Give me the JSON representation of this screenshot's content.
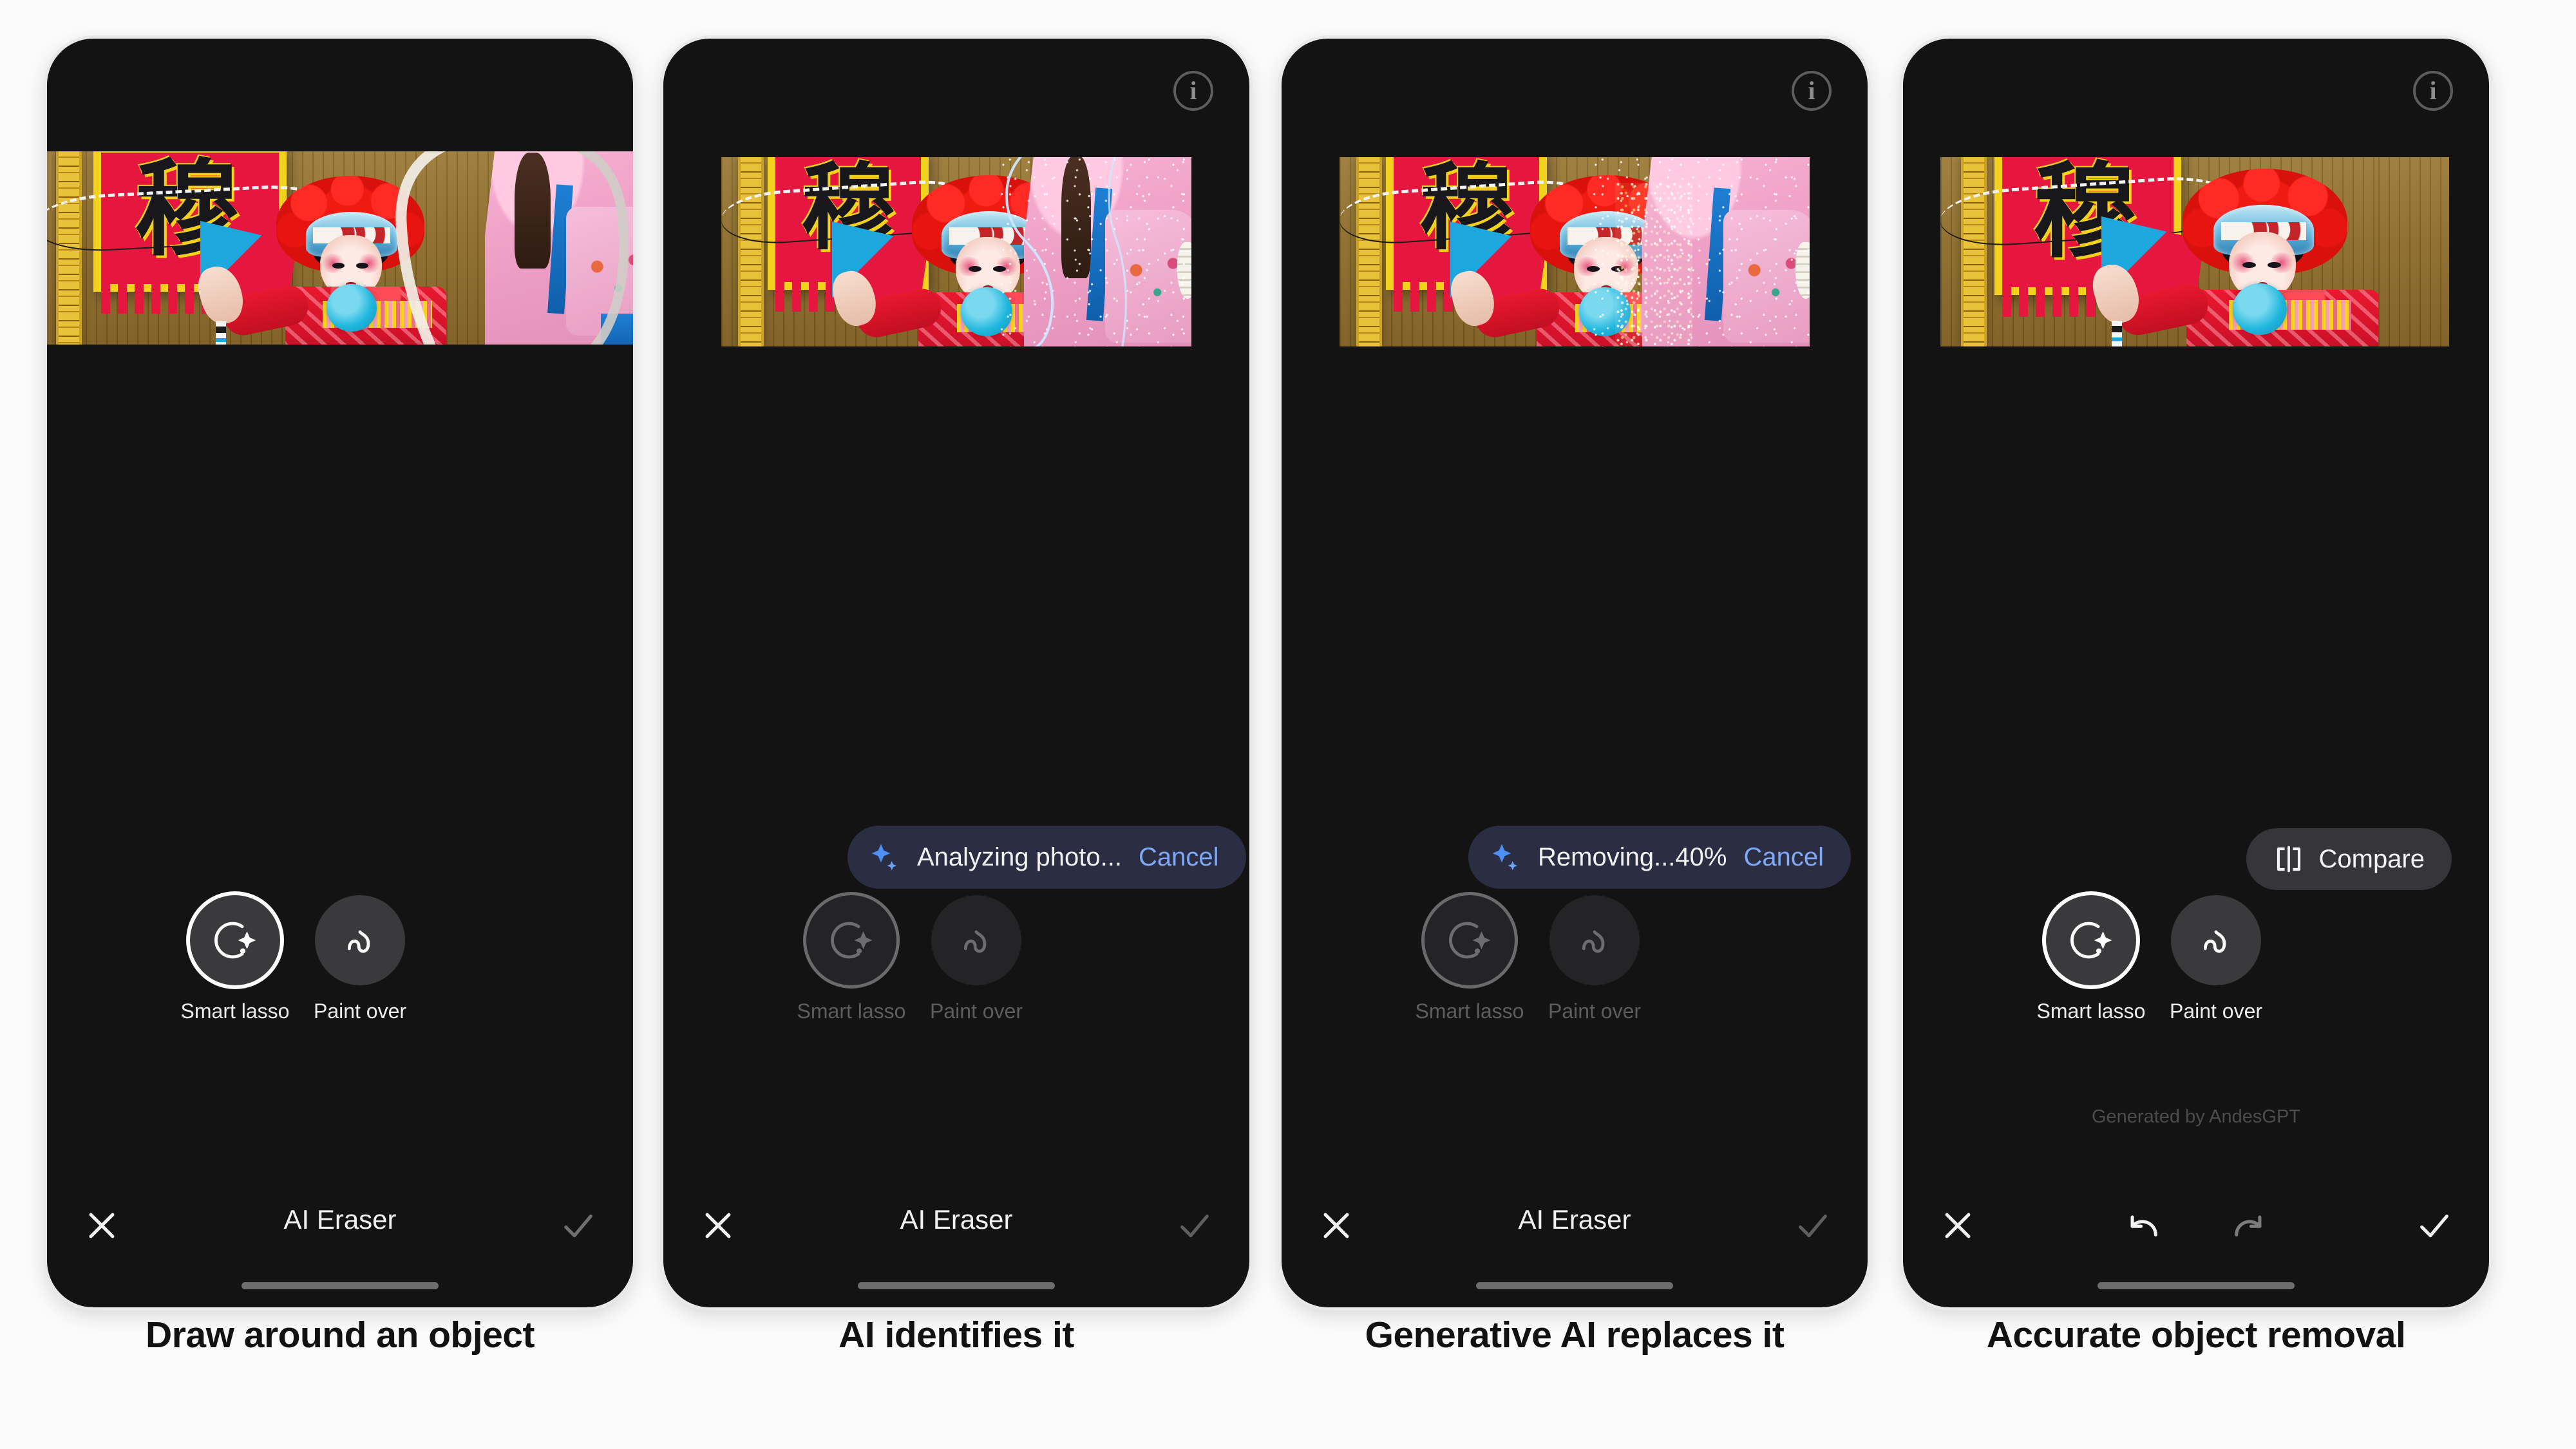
{
  "app": {
    "title": "AI Eraser",
    "accent_blue": "#7ea9f9",
    "pill_bg": "#2b2e42",
    "phone_bg": "#131313"
  },
  "icons": {
    "info": "info-icon",
    "sparkle": "sparkle-icon",
    "smart_lasso": "smart-lasso-icon",
    "paint_over": "paint-over-icon",
    "compare": "compare-split-icon",
    "close": "close-x-icon",
    "confirm": "checkmark-icon",
    "undo": "undo-arrow-icon",
    "redo": "redo-arrow-icon"
  },
  "tools": {
    "smart_lasso_label": "Smart lasso",
    "paint_over_label": "Paint over"
  },
  "panels": [
    {
      "id": "panel-draw",
      "caption": "Draw around an object",
      "has_info": false,
      "pill": null,
      "compare": null,
      "generated_by": null,
      "tools_enabled": true,
      "bottom_title": "AI Eraser",
      "bottom_mode": "confirm",
      "photo_state": "lasso-stroke-drawn"
    },
    {
      "id": "panel-analyzing",
      "caption": "AI identifies it",
      "has_info": true,
      "pill": {
        "text": "Analyzing photo...",
        "cancel": "Cancel"
      },
      "compare": null,
      "generated_by": null,
      "tools_enabled": false,
      "bottom_title": "AI Eraser",
      "bottom_mode": "confirm",
      "photo_state": "selection-highlighted"
    },
    {
      "id": "panel-removing",
      "caption": "Generative AI replaces it",
      "has_info": true,
      "pill": {
        "text": "Removing...40%",
        "cancel": "Cancel"
      },
      "compare": null,
      "generated_by": null,
      "tools_enabled": false,
      "bottom_title": "AI Eraser",
      "bottom_mode": "confirm",
      "photo_state": "dissolving-particles",
      "progress_percent": 40
    },
    {
      "id": "panel-result",
      "caption": "Accurate object removal",
      "has_info": true,
      "pill": null,
      "compare": {
        "label": "Compare"
      },
      "generated_by": "Generated by AndesGPT",
      "tools_enabled": true,
      "bottom_title": null,
      "bottom_mode": "undo-redo",
      "photo_state": "object-removed"
    }
  ],
  "photo": {
    "subject": "Chinese opera child performer",
    "sign_character": "穆",
    "removed_object": "pink-robed figure on the right"
  }
}
